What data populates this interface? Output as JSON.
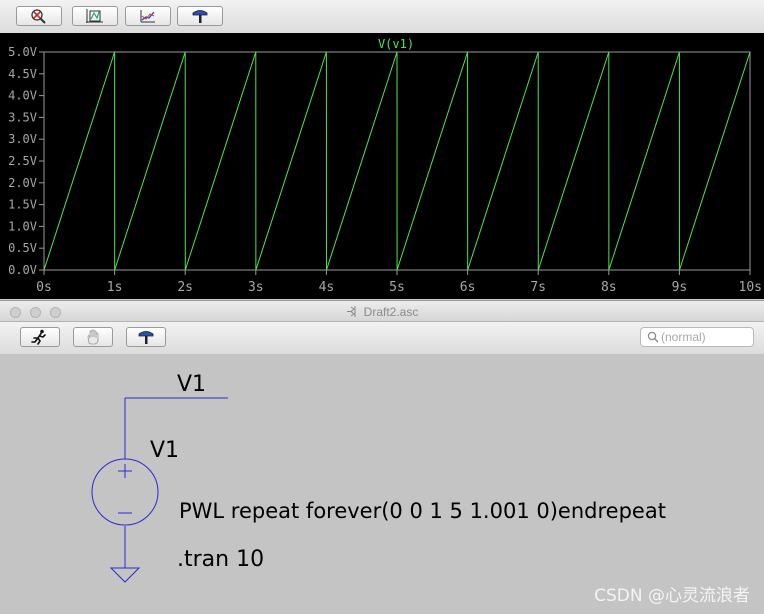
{
  "top_toolbar": {
    "buttons": [
      {
        "name": "zoom-cancel-button",
        "icon": "zoom-cancel-icon"
      },
      {
        "name": "autorange-button",
        "icon": "autorange-icon"
      },
      {
        "name": "pick-visible-traces-button",
        "icon": "pick-traces-icon"
      },
      {
        "name": "probe-button",
        "icon": "probe-hammer-icon"
      }
    ]
  },
  "plot": {
    "trace_label": "V(v1)",
    "trace_color": "#4ee44e",
    "background": "#000000"
  },
  "chart_data": {
    "type": "line",
    "title": "V(v1)",
    "xlabel": "",
    "ylabel": "",
    "xlim": [
      0,
      10
    ],
    "ylim": [
      0,
      5
    ],
    "x_ticks": [
      "0s",
      "1s",
      "2s",
      "3s",
      "4s",
      "5s",
      "6s",
      "7s",
      "8s",
      "9s",
      "10s"
    ],
    "y_ticks": [
      "0.0V",
      "0.5V",
      "1.0V",
      "1.5V",
      "2.0V",
      "2.5V",
      "3.0V",
      "3.5V",
      "4.0V",
      "4.5V",
      "5.0V"
    ],
    "grid": false,
    "series": [
      {
        "name": "V(v1)",
        "color": "#4ee44e",
        "x": [
          0,
          1,
          1.001,
          2,
          2.001,
          3,
          3.001,
          4,
          4.001,
          5,
          5.001,
          6,
          6.001,
          7,
          7.001,
          8,
          8.001,
          9,
          9.001,
          10
        ],
        "y": [
          0,
          5,
          0,
          5,
          0,
          5,
          0,
          5,
          0,
          5,
          0,
          5,
          0,
          5,
          0,
          5,
          0,
          5,
          0,
          5
        ]
      }
    ]
  },
  "schematic_window": {
    "title": "Draft2.asc",
    "search_placeholder": "(normal)",
    "buttons": [
      {
        "name": "run-button",
        "icon": "running-man-icon"
      },
      {
        "name": "halt-button",
        "icon": "hand-icon"
      },
      {
        "name": "probe-button",
        "icon": "probe-hammer-icon"
      }
    ]
  },
  "schematic": {
    "net_label": "V1",
    "source_name": "V1",
    "source_value": "PWL repeat forever(0 0 1 5 1.001 0)endrepeat",
    "directive": ".tran 10",
    "wire_color": "#2a2ad4"
  },
  "watermark": "CSDN @心灵流浪者"
}
